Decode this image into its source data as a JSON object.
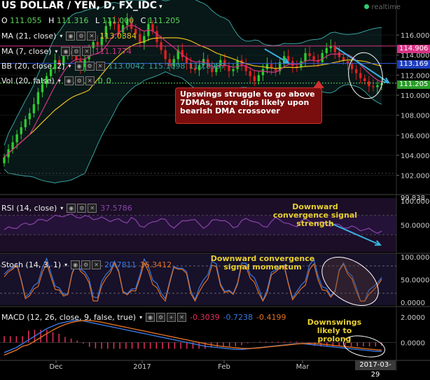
{
  "header": {
    "title": "US DOLLAR / YEN, D, FX_IDC",
    "realtime": "realtime",
    "ohlc": [
      {
        "k": "O",
        "v": "111.055"
      },
      {
        "k": "H",
        "v": "111.316"
      },
      {
        "k": "L",
        "v": "111.000"
      },
      {
        "k": "C",
        "v": "111.205"
      }
    ]
  },
  "indicators": {
    "ma21": {
      "label": "MA (21, close)",
      "value": "113.0384"
    },
    "ma7": {
      "label": "MA (7, close)",
      "value": "111.1774"
    },
    "bb": {
      "label": "BB (20, close, 2)",
      "values": [
        "113.0042",
        "115.1098",
        "110.8987"
      ]
    },
    "vol": {
      "label": "Vol (20, false)",
      "values": [
        "0",
        "0"
      ]
    },
    "rsi": {
      "label": "RSI (14, close)",
      "value": "37.5786"
    },
    "stoch": {
      "label": "Stoch (14, 3, 1)",
      "values": [
        "20.7811",
        "16.3412"
      ]
    },
    "macd": {
      "label": "MACD (12, 26, close, 9, false, true)",
      "values": [
        "-0.3039",
        "-0.7238",
        "-0.4199"
      ]
    }
  },
  "price_axis": {
    "main": [
      "116.000",
      "114.000",
      "112.000",
      "110.000",
      "108.000",
      "106.000",
      "104.000",
      "102.000"
    ],
    "boxes": [
      {
        "label": "114.906",
        "color": "#d63384"
      },
      {
        "label": "113.169",
        "color": "#1f3fbf"
      },
      {
        "label": "111.205",
        "color": "#2a9d2a"
      }
    ],
    "rsi": [
      "100.000",
      "50.0000"
    ],
    "stoch": [
      "100.000",
      "50.0000",
      "0.0000"
    ],
    "macd": [
      "2.0000",
      "0.0000"
    ],
    "cut": "99.838"
  },
  "time_axis": [
    "Dec",
    "2017",
    "Feb",
    "Mar"
  ],
  "current_date": "2017-03-29",
  "annotations": {
    "callout": "Upswings struggle to go above 7DMAs, more dips likely upon bearish DMA crossover",
    "rsi_note": "Downward convergence signal strength",
    "stoch_note": "Downward convergence signal momentum",
    "macd_note": "Downswings likely to prolong"
  },
  "colors": {
    "up": "#2ecc2e",
    "down": "#e02020",
    "ma21": "#e8c020",
    "ma7": "#d63384",
    "bb": "#3aa0a0",
    "rsi": "#8844aa",
    "stoch_k": "#3a78e0",
    "stoch_d": "#e07020",
    "macd": "#3a78e0",
    "signal": "#e07020",
    "hist": "#e83060",
    "arrow": "#3ab0e0"
  },
  "chart_data": {
    "type": "candlestick",
    "title": "US DOLLAR / YEN, D, FX_IDC",
    "x_labels": [
      "Dec",
      "2017",
      "Feb",
      "Mar"
    ],
    "ylim": [
      100.5,
      119.5
    ],
    "close": [
      103.8,
      104.6,
      105.3,
      106.1,
      106.8,
      107.6,
      108.2,
      109.1,
      110.3,
      111.1,
      111.9,
      112.6,
      113.5,
      113.0,
      113.9,
      114.4,
      114.1,
      113.5,
      112.8,
      113.6,
      114.7,
      115.3,
      115.0,
      115.8,
      116.9,
      117.4,
      117.1,
      116.3,
      117.0,
      117.6,
      116.6,
      116.1,
      115.2,
      115.9,
      117.1,
      116.4,
      115.3,
      114.5,
      113.6,
      112.9,
      113.6,
      114.5,
      113.8,
      113.2,
      112.7,
      112.5,
      113.0,
      113.6,
      112.8,
      112.3,
      112.9,
      113.5,
      112.9,
      112.4,
      112.6,
      113.5,
      113.0,
      112.4,
      111.9,
      111.4,
      112.0,
      112.6,
      113.1,
      112.7,
      112.4,
      113.3,
      113.9,
      113.4,
      112.9,
      112.8,
      113.4,
      114.2,
      113.9,
      113.5,
      113.3,
      114.2,
      114.7,
      114.9,
      114.3,
      113.8,
      113.4,
      113.1,
      112.6,
      112.2,
      111.7,
      111.4,
      110.9,
      110.8,
      111.0,
      111.2
    ],
    "macd": [
      -0.8,
      -0.6,
      -0.4,
      -0.1,
      0.2,
      0.5,
      0.8,
      1.1,
      1.3,
      1.5,
      1.6,
      1.7,
      1.75,
      1.7,
      1.6,
      1.5,
      1.4,
      1.3,
      1.2,
      1.1,
      1.0,
      0.9,
      0.8,
      0.7,
      0.6,
      0.5,
      0.4,
      0.3,
      0.2,
      0.1,
      0.0,
      -0.1,
      -0.2,
      -0.3,
      -0.35,
      -0.4,
      -0.45,
      -0.5,
      -0.55,
      -0.55,
      -0.5,
      -0.45,
      -0.4,
      -0.35,
      -0.3,
      -0.25,
      -0.2,
      -0.15,
      -0.1,
      -0.1,
      -0.15,
      -0.2,
      -0.25,
      -0.3,
      -0.35,
      -0.4,
      -0.45,
      -0.5,
      -0.55,
      -0.6,
      -0.65,
      -0.7,
      -0.72
    ],
    "rsi_current": 37.5786,
    "stoch_current": [
      20.7811,
      16.3412
    ],
    "macd_current": [
      -0.3039,
      -0.7238,
      -0.4199
    ]
  }
}
